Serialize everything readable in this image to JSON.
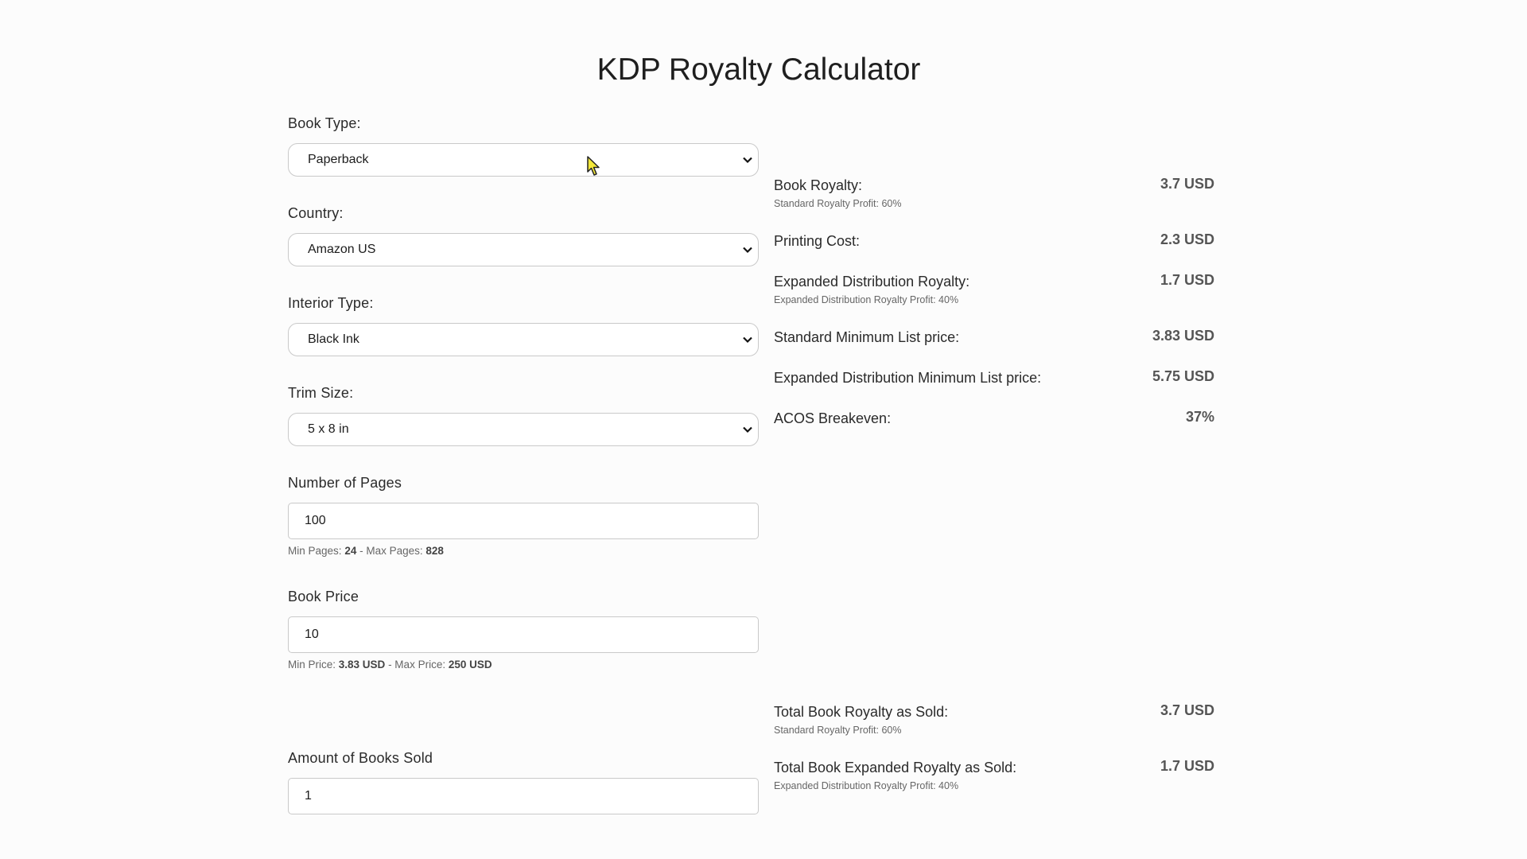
{
  "page": {
    "title": "KDP Royalty Calculator"
  },
  "form": {
    "book_type": {
      "label": "Book Type:",
      "value": "Paperback"
    },
    "country": {
      "label": "Country:",
      "value": "Amazon US"
    },
    "interior_type": {
      "label": "Interior Type:",
      "value": "Black Ink"
    },
    "trim_size": {
      "label": "Trim Size:",
      "value": "5 x 8 in"
    },
    "pages": {
      "label": "Number of Pages",
      "value": "100",
      "hint_min_label": "Min Pages:",
      "hint_min_value": "24",
      "hint_sep": " - Max Pages:",
      "hint_max_value": "828"
    },
    "price": {
      "label": "Book Price",
      "value": "10",
      "hint_min_label": "Min Price:",
      "hint_min_value": "3.83 USD",
      "hint_sep": " - Max Price:",
      "hint_max_value": "250 USD"
    },
    "sold": {
      "label": "Amount of Books Sold",
      "value": "1"
    }
  },
  "results": {
    "book_royalty": {
      "label": "Book Royalty:",
      "sub": "Standard Royalty Profit: 60%",
      "value": "3.7 USD"
    },
    "printing_cost": {
      "label": "Printing Cost:",
      "value": "2.3 USD"
    },
    "expanded_royalty": {
      "label": "Expanded Distribution Royalty:",
      "sub": "Expanded Distribution Royalty Profit: 40%",
      "value": "1.7 USD"
    },
    "std_min_price": {
      "label": "Standard Minimum List price:",
      "value": "3.83 USD"
    },
    "exp_min_price": {
      "label": "Expanded Distribution Minimum List price:",
      "value": "5.75 USD"
    },
    "acos": {
      "label": "ACOS Breakeven:",
      "value": "37%"
    }
  },
  "totals": {
    "total_royalty": {
      "label": "Total Book Royalty as Sold:",
      "sub": "Standard Royalty Profit: 60%",
      "value": "3.7 USD"
    },
    "total_expanded": {
      "label": "Total Book Expanded Royalty as Sold:",
      "sub": "Expanded Distribution Royalty Profit: 40%",
      "value": "1.7 USD"
    }
  },
  "icons": {
    "dropdown": "chevron-down-icon",
    "cursor": "mouse-pointer-icon"
  },
  "colors": {
    "background": "#fcfcfc",
    "value_text": "#555555"
  }
}
